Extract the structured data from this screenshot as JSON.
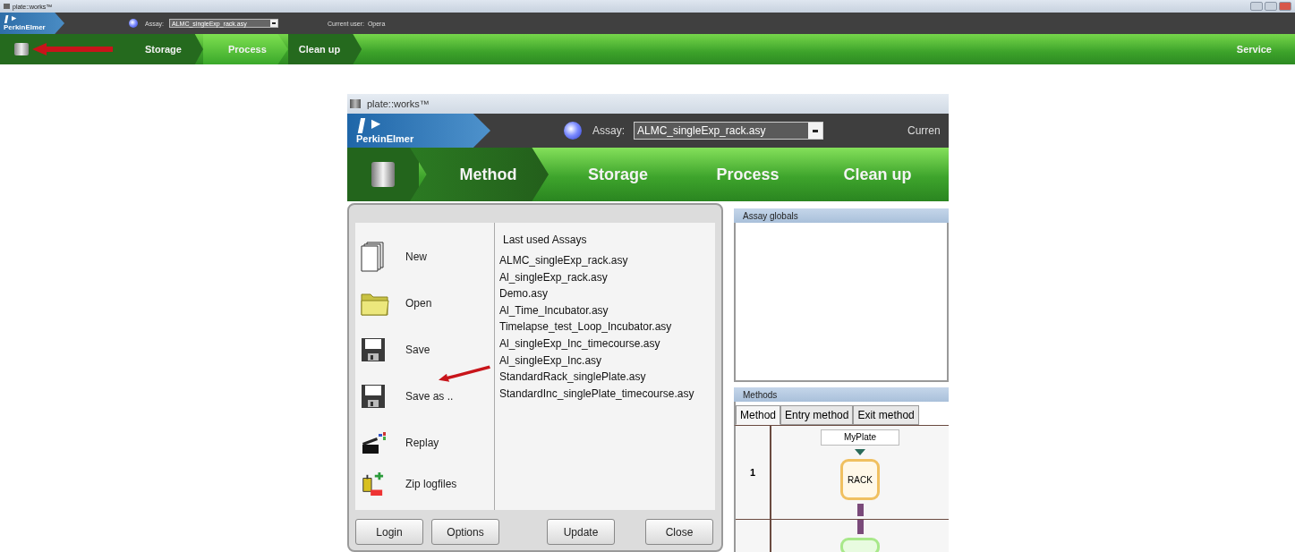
{
  "overview": {
    "window": {
      "title": "plate::works™"
    },
    "logo_text": "PerkinElmer",
    "assay_label": "Assay:",
    "assay_value": "ALMC_singleExp_rack.asy",
    "user_label": "Current user:",
    "user": "Opera",
    "nav": [
      {
        "label": "Storage",
        "selected": false
      },
      {
        "label": "Process",
        "selected": true
      },
      {
        "label": "Clean up",
        "selected": false
      }
    ],
    "service": "Service"
  },
  "detail": {
    "window": {
      "title": "plate::works™"
    },
    "logo_text": "PerkinElmer",
    "assay_label": "Assay:",
    "assay_value": "ALMC_singleExp_rack.asy",
    "user_label": "Curren",
    "nav": [
      {
        "label": "Method",
        "selected": true
      },
      {
        "label": "Storage",
        "selected": false
      },
      {
        "label": "Process",
        "selected": false
      },
      {
        "label": "Clean up",
        "selected": false
      }
    ],
    "menu": [
      {
        "label": "New",
        "kind": "new"
      },
      {
        "label": "Open",
        "kind": "open"
      },
      {
        "label": "Save",
        "kind": "save"
      },
      {
        "label": "Save as ..",
        "kind": "save"
      },
      {
        "label": "Replay",
        "kind": "replay"
      },
      {
        "label": "Zip logfiles",
        "kind": "zip"
      }
    ],
    "recent_title": "Last used Assays",
    "recent": [
      "ALMC_singleExp_rack.asy",
      "Al_singleExp_rack.asy",
      "Demo.asy",
      "Al_Time_Incubator.asy",
      "Timelapse_test_Loop_Incubator.asy",
      "Al_singleExp_Inc_timecourse.asy",
      "Al_singleExp_Inc.asy",
      "StandardRack_singlePlate.asy",
      "StandardInc_singlePlate_timecourse.asy"
    ],
    "buttons": [
      "Login",
      "Options",
      "Update",
      "Close"
    ],
    "assay_globals": {
      "title": "Assay globals"
    },
    "methods": {
      "title": "Methods",
      "tabs": [
        {
          "label": "Method",
          "selected": true
        },
        {
          "label": "Entry method",
          "selected": false
        },
        {
          "label": "Exit method",
          "selected": false
        }
      ],
      "rows": [
        {
          "number": "1",
          "source": "MyPlate",
          "node": "RACK"
        }
      ]
    }
  }
}
